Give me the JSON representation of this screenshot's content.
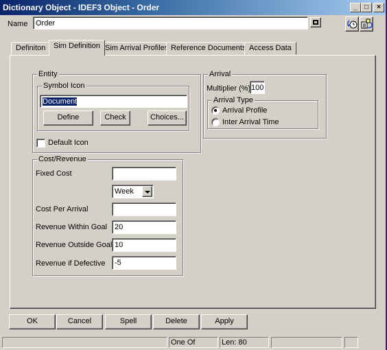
{
  "window": {
    "title": "Dictionary Object - IDEF3 Object - Order",
    "minimize_glyph": "_",
    "maximize_glyph": "□",
    "close_glyph": "×"
  },
  "header": {
    "name_label": "Name",
    "name_value": "Order"
  },
  "tabs": [
    {
      "label": "Definiton",
      "active": false
    },
    {
      "label": "Sim Definition",
      "active": true
    },
    {
      "label": "Sim Arrival Profiles",
      "active": false
    },
    {
      "label": "Reference Documents",
      "active": false
    },
    {
      "label": "Access Data",
      "active": false
    }
  ],
  "entity": {
    "group_label": "Entity",
    "symbol_icon_label": "Symbol Icon",
    "symbol_icon_value": "Document",
    "define_button": "Define",
    "check_button": "Check",
    "choices_button": "Choices...",
    "default_icon_label": "Default Icon",
    "default_icon_checked": false
  },
  "arrival": {
    "group_label": "Arrival",
    "multiplier_label": "Multiplier (%)",
    "multiplier_value": "100",
    "arrival_type_label": "Arrival Type",
    "options": [
      {
        "label": "Arrival Profile",
        "selected": true
      },
      {
        "label": "Inter Arrival Time",
        "selected": false
      }
    ]
  },
  "cost_revenue": {
    "group_label": "Cost/Revenue",
    "fixed_cost_label": "Fixed Cost",
    "fixed_cost_value": "",
    "period_value": "Week",
    "cost_per_arrival_label": "Cost Per Arrival",
    "cost_per_arrival_value": "",
    "revenue_within_goal_label": "Revenue Within Goal",
    "revenue_within_goal_value": "20",
    "revenue_outside_goal_label": "Revenue Outside Goal",
    "revenue_outside_goal_value": "10",
    "revenue_if_defective_label": "Revenue if Defective",
    "revenue_if_defective_value": "-5"
  },
  "buttons": {
    "ok": "OK",
    "cancel": "Cancel",
    "spell": "Spell",
    "delete": "Delete",
    "apply": "Apply"
  },
  "statusbar": {
    "field1": "",
    "field2": "One Of",
    "field3": "Len: 80",
    "field4": "",
    "field5": ""
  }
}
